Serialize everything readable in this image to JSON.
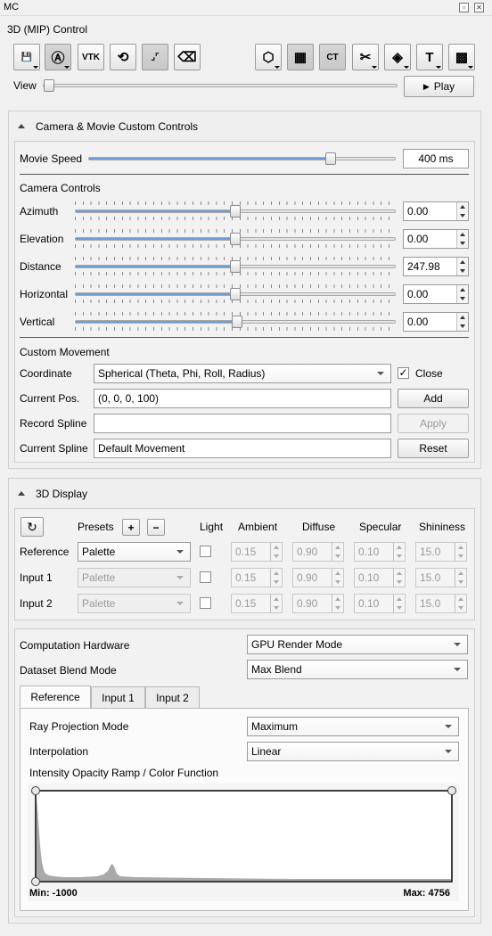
{
  "window": {
    "title": "MC"
  },
  "panel_title": "3D (MIP) Control",
  "toolbar": {
    "buttons": [
      {
        "icon": "save-icon",
        "glyph": "💾"
      },
      {
        "icon": "auto-icon",
        "glyph": "Ⓐ"
      },
      {
        "icon": "vtk-icon",
        "glyph": "VTK"
      },
      {
        "icon": "reset-view-icon",
        "glyph": "⟲"
      },
      {
        "icon": "collapse-icon",
        "glyph": "⌟⌜"
      },
      {
        "icon": "eraser-icon",
        "glyph": "⌫"
      },
      {
        "icon": "cube-icon",
        "glyph": "⬡"
      },
      {
        "icon": "checker-icon",
        "glyph": "▦"
      },
      {
        "icon": "ct-icon",
        "glyph": "CT"
      },
      {
        "icon": "crop-icon",
        "glyph": "✂"
      },
      {
        "icon": "dvd-cube-icon",
        "glyph": "◈"
      },
      {
        "icon": "text-icon",
        "glyph": "T"
      },
      {
        "icon": "grid-icon",
        "glyph": "▩"
      }
    ],
    "view_label": "View",
    "play_label": "Play",
    "play_icon": "play-icon"
  },
  "camera_section": {
    "title": "Camera & Movie Custom Controls",
    "movie_speed_label": "Movie Speed",
    "movie_speed_value": "400 ms",
    "camera_controls_label": "Camera Controls",
    "sliders": [
      {
        "label": "Azimuth",
        "value": "0.00"
      },
      {
        "label": "Elevation",
        "value": "0.00"
      },
      {
        "label": "Distance",
        "value": "247.98"
      },
      {
        "label": "Horizontal",
        "value": "0.00"
      },
      {
        "label": "Vertical",
        "value": "0.00"
      }
    ],
    "custom_movement_label": "Custom Movement",
    "coordinate_label": "Coordinate",
    "coordinate_value": "Spherical (Theta, Phi, Roll, Radius)",
    "close_label": "Close",
    "current_pos_label": "Current Pos.",
    "current_pos_value": "(0, 0, 0, 100)",
    "add_label": "Add",
    "record_spline_label": "Record Spline",
    "record_spline_value": "",
    "apply_label": "Apply",
    "current_spline_label": "Current Spline",
    "current_spline_value": "Default Movement",
    "reset_label": "Reset"
  },
  "display_section": {
    "title": "3D Display",
    "columns": {
      "presets": "Presets",
      "light": "Light",
      "ambient": "Ambient",
      "diffuse": "Diffuse",
      "specular": "Specular",
      "shininess": "Shininess"
    },
    "rows": [
      {
        "label": "Reference",
        "preset": "Palette",
        "ambient": "0.15",
        "diffuse": "0.90",
        "specular": "0.10",
        "shininess": "15.0"
      },
      {
        "label": "Input 1",
        "preset": "Palette",
        "ambient": "0.15",
        "diffuse": "0.90",
        "specular": "0.10",
        "shininess": "15.0"
      },
      {
        "label": "Input 2",
        "preset": "Palette",
        "ambient": "0.15",
        "diffuse": "0.90",
        "specular": "0.10",
        "shininess": "15.0"
      }
    ],
    "computation_hardware_label": "Computation Hardware",
    "computation_hardware_value": "GPU Render Mode",
    "dataset_blend_label": "Dataset Blend Mode",
    "dataset_blend_value": "Max Blend",
    "tabs": [
      "Reference",
      "Input 1",
      "Input 2"
    ],
    "ray_projection_label": "Ray Projection Mode",
    "ray_projection_value": "Maximum",
    "interpolation_label": "Interpolation",
    "interpolation_value": "Linear",
    "ramp_label": "Intensity Opacity Ramp / Color Function",
    "min_label": "Min: -1000",
    "max_label": "Max: 4756"
  }
}
